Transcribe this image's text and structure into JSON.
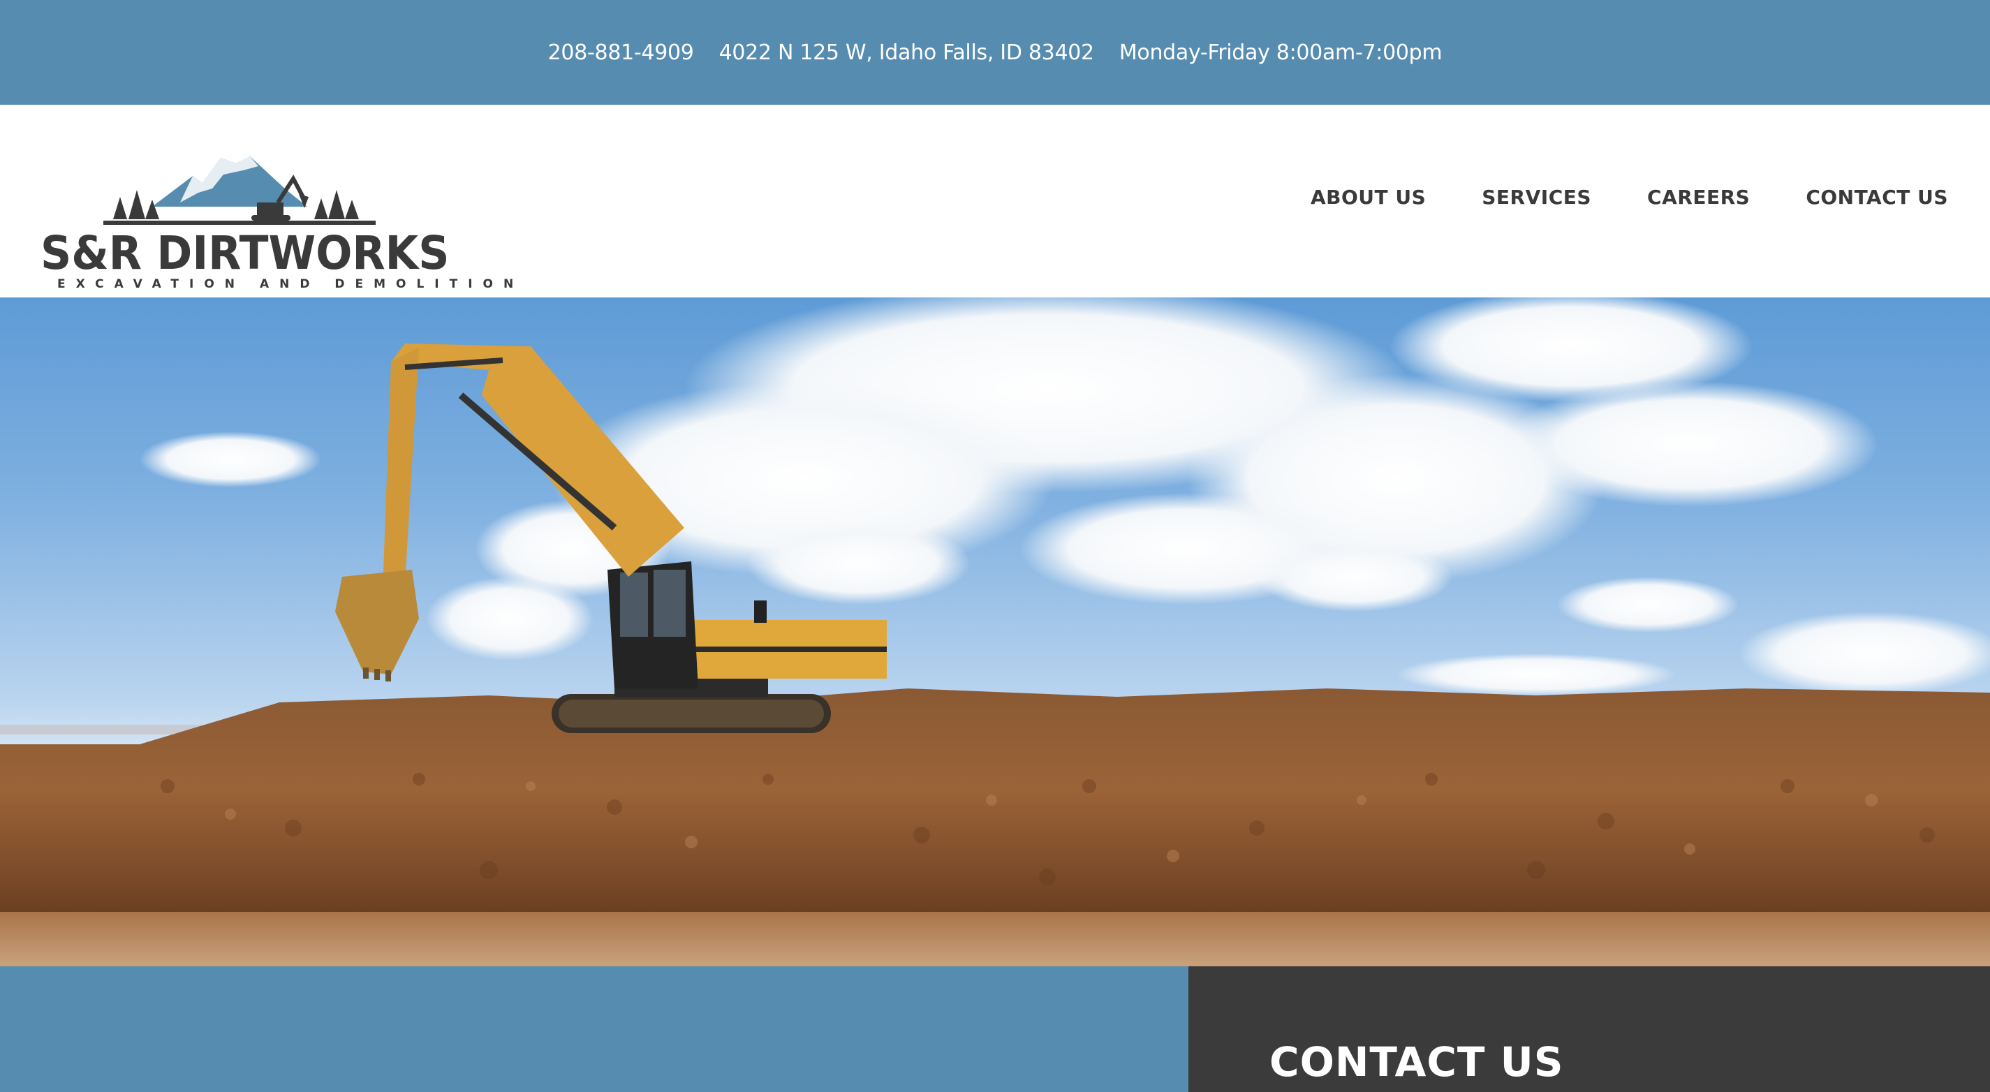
{
  "topbar": {
    "phone": "208-881-4909",
    "address": "4022 N 125 W, Idaho Falls, ID 83402",
    "hours": "Monday-Friday 8:00am-7:00pm"
  },
  "logo": {
    "name": "S&R DIRTWORKS",
    "tagline": "EXCAVATION AND DEMOLITION"
  },
  "nav": {
    "items": [
      {
        "label": "ABOUT US"
      },
      {
        "label": "SERVICES"
      },
      {
        "label": "CAREERS"
      },
      {
        "label": "CONTACT US"
      }
    ]
  },
  "hero": {
    "image": "excavator-on-dirt-mound"
  },
  "contact": {
    "heading": "CONTACT US"
  },
  "colors": {
    "brand_blue": "#568cb0",
    "dark_gray": "#3b3b3b",
    "text_dark": "#3a3a3a",
    "white": "#ffffff"
  }
}
